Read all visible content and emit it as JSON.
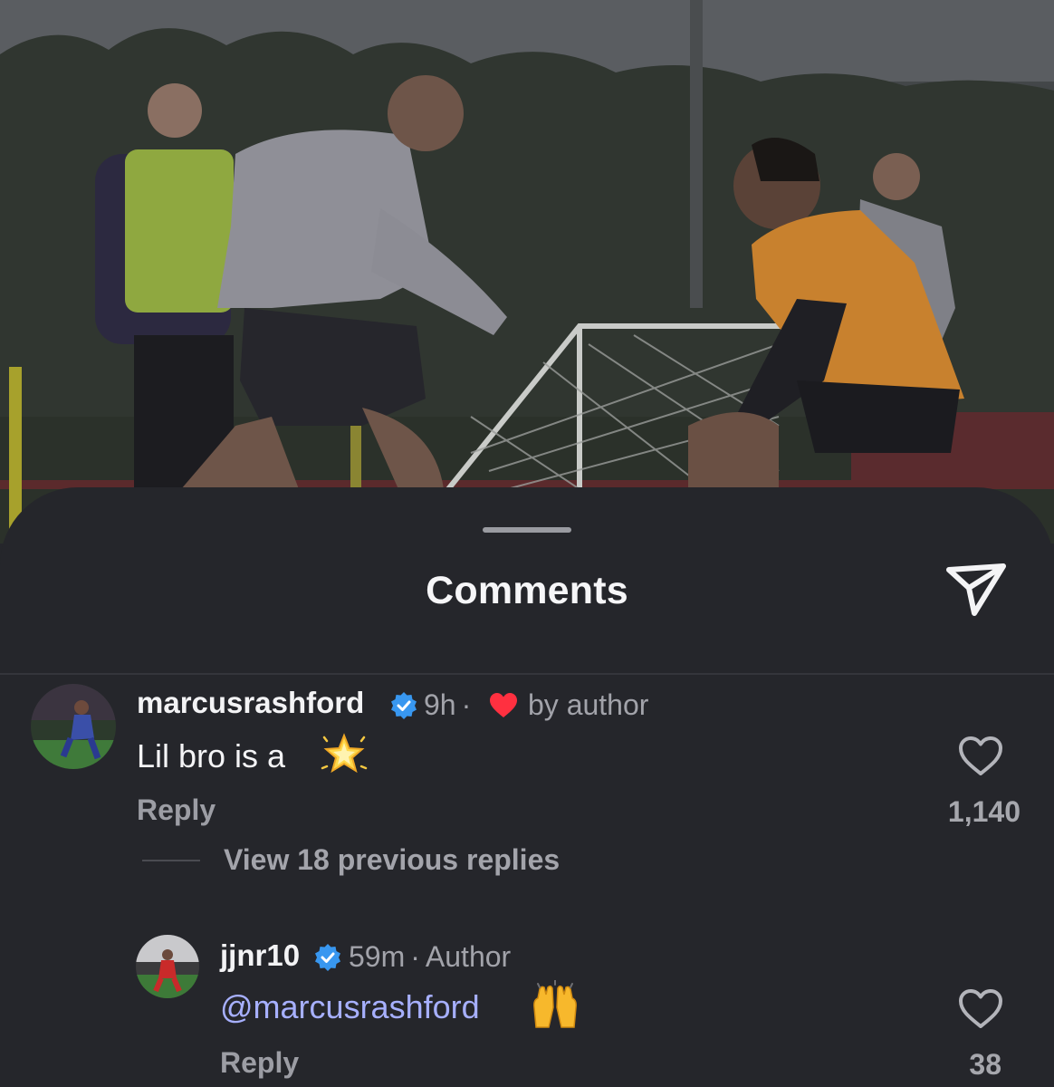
{
  "sheet": {
    "title": "Comments",
    "share_icon": "send-icon"
  },
  "comments": [
    {
      "username": "marcusrashford",
      "verified": true,
      "time": "9h",
      "separator": "·",
      "liked_by_author_label": "by author",
      "text": "Lil bro is a",
      "emoji": "glowing-star",
      "reply_label": "Reply",
      "likes": "1,140",
      "view_replies_label": "View 18 previous replies"
    },
    {
      "username": "jjnr10",
      "verified": true,
      "time": "59m",
      "separator": "·",
      "role_label": "Author",
      "mention": "@marcusrashford",
      "emoji": "raising-hands",
      "reply_label": "Reply",
      "likes": "38"
    }
  ],
  "colors": {
    "sheet_bg": "#25262b",
    "verified_blue": "#3897f0",
    "heart_red": "#ff3040",
    "mention": "#a7b0ff"
  }
}
